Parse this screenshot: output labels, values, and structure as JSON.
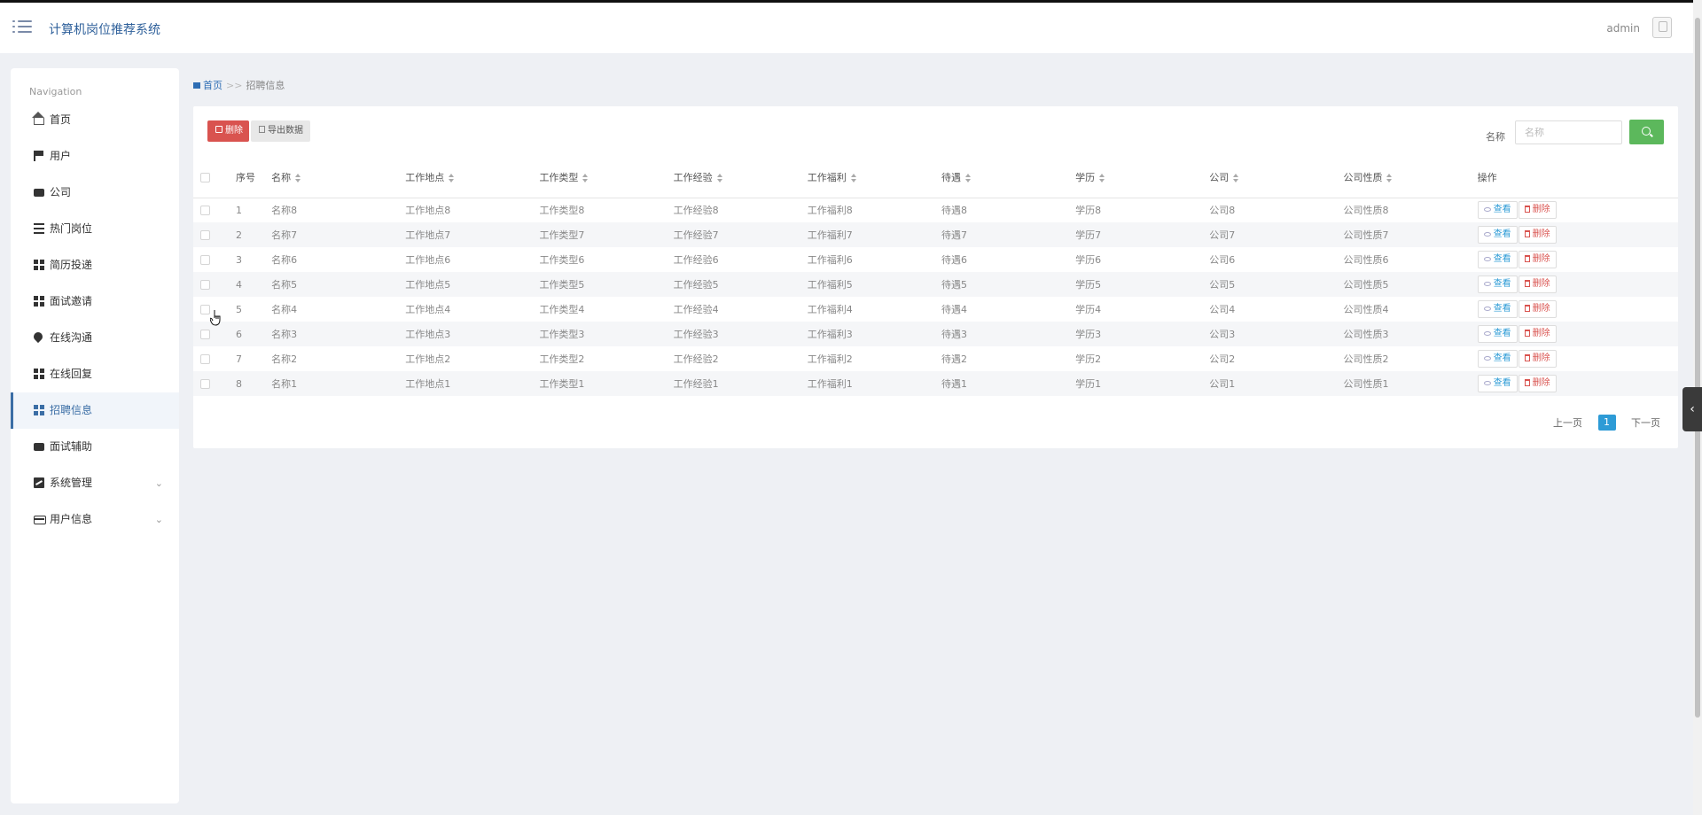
{
  "header": {
    "title": "计算机岗位推荐系统",
    "user": "admin"
  },
  "sidebar": {
    "title": "Navigation",
    "items": [
      {
        "label": "首页",
        "icon": "home-icon"
      },
      {
        "label": "用户",
        "icon": "flag-icon"
      },
      {
        "label": "公司",
        "icon": "briefcase-icon"
      },
      {
        "label": "热门岗位",
        "icon": "list-icon"
      },
      {
        "label": "简历投递",
        "icon": "grid-icon"
      },
      {
        "label": "面试邀请",
        "icon": "grid-icon"
      },
      {
        "label": "在线沟通",
        "icon": "map-marker-icon"
      },
      {
        "label": "在线回复",
        "icon": "grid-icon"
      },
      {
        "label": "招聘信息",
        "icon": "grid-icon",
        "active": true
      },
      {
        "label": "面试辅助",
        "icon": "chat-icon"
      },
      {
        "label": "系统管理",
        "icon": "chart-icon",
        "expandable": true
      },
      {
        "label": "用户信息",
        "icon": "card-icon",
        "expandable": true
      }
    ]
  },
  "breadcrumb": {
    "home": "首页",
    "separator": ">>",
    "current": "招聘信息"
  },
  "toolbar": {
    "delete_label": "删除",
    "export_label": "导出数据",
    "search_label": "名称",
    "search_placeholder": "名称",
    "search_value": ""
  },
  "table": {
    "headers": [
      "序号",
      "名称",
      "工作地点",
      "工作类型",
      "工作经验",
      "工作福利",
      "待遇",
      "学历",
      "公司",
      "公司性质",
      "操作"
    ],
    "rows": [
      [
        "1",
        "名称8",
        "工作地点8",
        "工作类型8",
        "工作经验8",
        "工作福利8",
        "待遇8",
        "学历8",
        "公司8",
        "公司性质8"
      ],
      [
        "2",
        "名称7",
        "工作地点7",
        "工作类型7",
        "工作经验7",
        "工作福利7",
        "待遇7",
        "学历7",
        "公司7",
        "公司性质7"
      ],
      [
        "3",
        "名称6",
        "工作地点6",
        "工作类型6",
        "工作经验6",
        "工作福利6",
        "待遇6",
        "学历6",
        "公司6",
        "公司性质6"
      ],
      [
        "4",
        "名称5",
        "工作地点5",
        "工作类型5",
        "工作经验5",
        "工作福利5",
        "待遇5",
        "学历5",
        "公司5",
        "公司性质5"
      ],
      [
        "5",
        "名称4",
        "工作地点4",
        "工作类型4",
        "工作经验4",
        "工作福利4",
        "待遇4",
        "学历4",
        "公司4",
        "公司性质4"
      ],
      [
        "6",
        "名称3",
        "工作地点3",
        "工作类型3",
        "工作经验3",
        "工作福利3",
        "待遇3",
        "学历3",
        "公司3",
        "公司性质3"
      ],
      [
        "7",
        "名称2",
        "工作地点2",
        "工作类型2",
        "工作经验2",
        "工作福利2",
        "待遇2",
        "学历2",
        "公司2",
        "公司性质2"
      ],
      [
        "8",
        "名称1",
        "工作地点1",
        "工作类型1",
        "工作经验1",
        "工作福利1",
        "待遇1",
        "学历1",
        "公司1",
        "公司性质1"
      ]
    ],
    "view_label": "查看",
    "delete_label": "删除"
  },
  "pagination": {
    "prev": "上一页",
    "current": "1",
    "next": "下一页"
  },
  "colors": {
    "brand": "#2d5f9a",
    "danger": "#d9534f",
    "success": "#5cb85c",
    "info": "#2d9bd6"
  }
}
